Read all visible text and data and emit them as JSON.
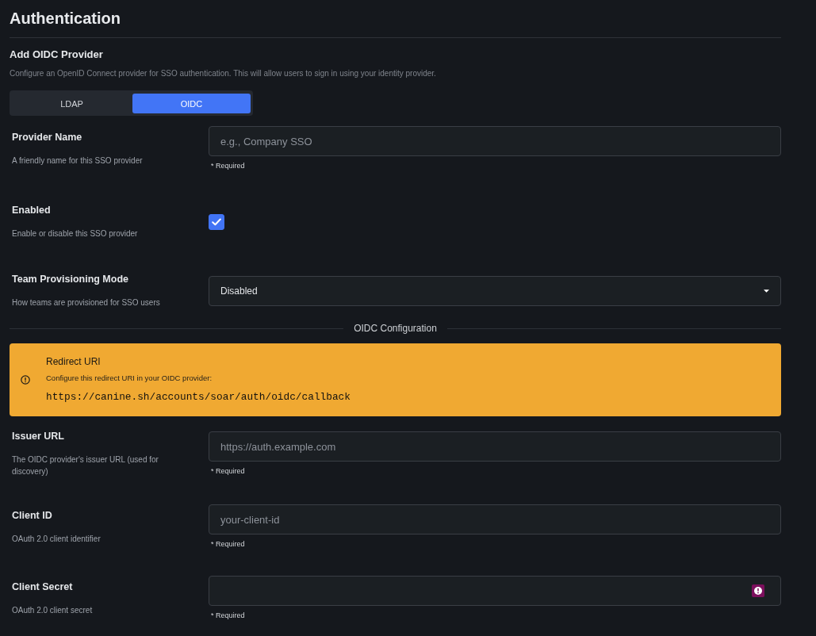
{
  "page": {
    "title": "Authentication"
  },
  "section": {
    "title": "Add OIDC Provider",
    "description": "Configure an OpenID Connect provider for SSO authentication. This will allow users to sign in using your identity provider."
  },
  "provider_type_tabs": [
    {
      "label": "LDAP",
      "selected": false
    },
    {
      "label": "OIDC",
      "selected": true
    }
  ],
  "general_fields": [
    {
      "kind": "text",
      "label": "Provider Name",
      "hint": "A friendly name for this SSO provider",
      "placeholder": "e.g., Company SSO",
      "note": "* Required"
    },
    {
      "kind": "checkbox",
      "label": "Enabled",
      "hint": "Enable or disable this SSO provider",
      "checked": true
    },
    {
      "kind": "select",
      "label": "Team Provisioning Mode",
      "hint": "How teams are provisioned for SSO users",
      "value": "Disabled"
    }
  ],
  "divider": {
    "label": "OIDC Configuration"
  },
  "alert": {
    "title": "Redirect URI",
    "message": "Configure this redirect URI in your OIDC provider:",
    "uri": "https://canine.sh/accounts/soar/auth/oidc/callback"
  },
  "oidc_fields": [
    {
      "kind": "text",
      "label": "Issuer URL",
      "hint": "The OIDC provider's issuer URL (used for discovery)",
      "placeholder": "https://auth.example.com",
      "note": "* Required"
    },
    {
      "kind": "text",
      "label": "Client ID",
      "hint": "OAuth 2.0 client identifier",
      "placeholder": "your-client-id",
      "note": "* Required"
    },
    {
      "kind": "password",
      "label": "Client Secret",
      "hint": "OAuth 2.0 client secret",
      "note": "* Required"
    }
  ]
}
